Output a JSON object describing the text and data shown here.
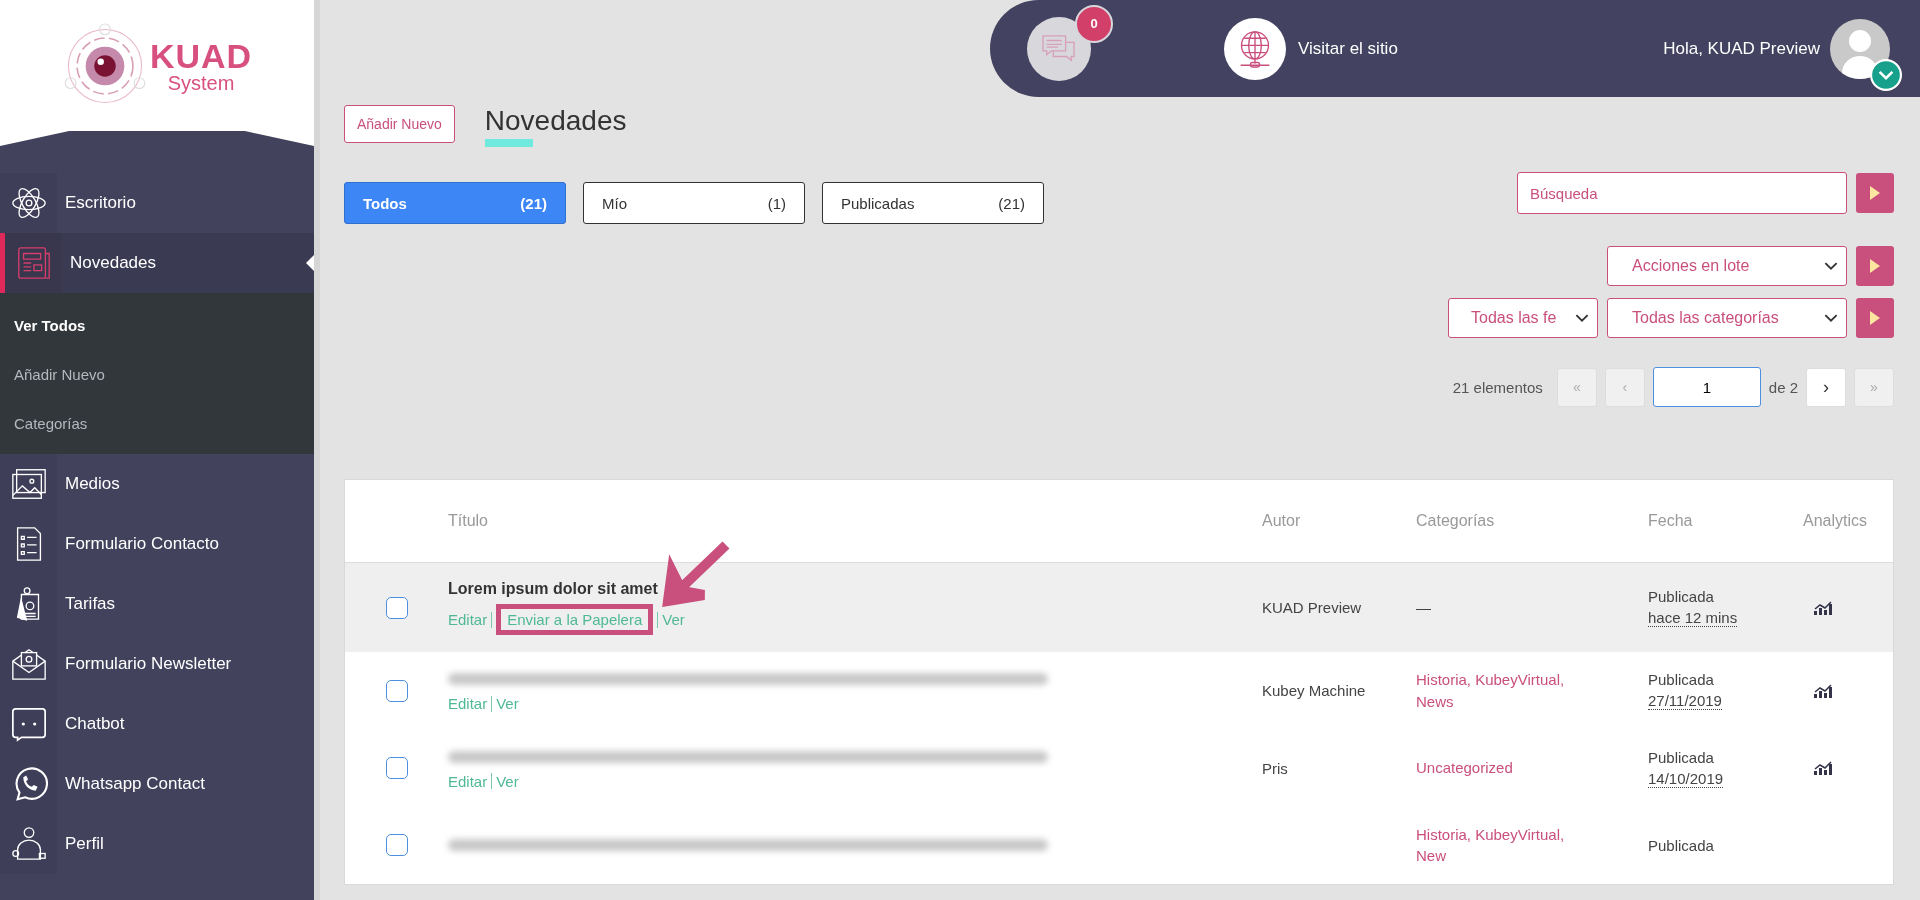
{
  "logo": {
    "word": "KUAD",
    "sub": "System"
  },
  "sidebar": {
    "items": [
      {
        "label": "Escritorio",
        "selected": false
      },
      {
        "label": "Novedades",
        "selected": true,
        "expanded": true,
        "children": [
          {
            "label": "Ver Todos",
            "selected": true
          },
          {
            "label": "Añadir Nuevo",
            "selected": false
          },
          {
            "label": "Categorías",
            "selected": false
          }
        ]
      },
      {
        "label": "Medios",
        "selected": false
      },
      {
        "label": "Formulario Contacto",
        "selected": false
      },
      {
        "label": "Tarifas",
        "selected": false
      },
      {
        "label": "Formulario Newsletter",
        "selected": false
      },
      {
        "label": "Chatbot",
        "selected": false
      },
      {
        "label": "Whatsapp Contact",
        "selected": false
      },
      {
        "label": "Perfil",
        "selected": false
      }
    ]
  },
  "topbar": {
    "messages_badge": "0",
    "visit_site": "Visitar el sitio",
    "greeting": "Hola, KUAD Preview"
  },
  "page": {
    "add_button": "Añadir Nuevo",
    "title": "Novedades"
  },
  "views": [
    {
      "label": "Todos",
      "count": "(21)",
      "selected": true
    },
    {
      "label": "Mío",
      "count": "(1)",
      "selected": false
    },
    {
      "label": "Publicadas",
      "count": "(21)",
      "selected": false
    }
  ],
  "search": {
    "placeholder": "Búsqueda"
  },
  "bulk_actions": {
    "value": "Acciones en lote"
  },
  "filters": [
    {
      "value": "Todas las fe"
    },
    {
      "value": "Todas las categorías"
    }
  ],
  "pagination": {
    "count": "21 elementos",
    "first": {
      "label": "«",
      "disabled": true
    },
    "prev": {
      "label": "‹",
      "disabled": true
    },
    "page": "1",
    "of": "de 2",
    "next": {
      "label": "›",
      "disabled": false
    },
    "last": {
      "label": "»",
      "disabled": true
    }
  },
  "table": {
    "columns": [
      "Título",
      "Autor",
      "Categorías",
      "Fecha",
      "Analytics"
    ],
    "rows": [
      {
        "checked": false,
        "hovered": true,
        "title": {
          "kind": "text",
          "text": "Lorem ipsum dolor sit amet"
        },
        "actions": [
          {
            "label": "Editar",
            "highlighted": false
          },
          {
            "label": "Enviar a la Papelera",
            "highlighted": true
          },
          {
            "label": "Ver",
            "highlighted": false
          }
        ],
        "author": "KUAD Preview",
        "categories": {
          "kind": "empty",
          "text": "—"
        },
        "status": "Publicada",
        "date": "hace 12 mins"
      },
      {
        "checked": false,
        "hovered": false,
        "title": {
          "kind": "blurred"
        },
        "actions": [
          {
            "label": "Editar",
            "highlighted": false
          },
          {
            "label": "Ver",
            "highlighted": false
          }
        ],
        "author": "Kubey Machine",
        "categories": {
          "kind": "links",
          "text": "Historia, KubeyVirtual, News"
        },
        "status": "Publicada",
        "date": "27/11/2019"
      },
      {
        "checked": false,
        "hovered": false,
        "title": {
          "kind": "blurred"
        },
        "actions": [
          {
            "label": "Editar",
            "highlighted": false
          },
          {
            "label": "Ver",
            "highlighted": false
          }
        ],
        "author": "Pris",
        "categories": {
          "kind": "links",
          "text": "Uncategorized"
        },
        "status": "Publicada",
        "date": "14/10/2019"
      },
      {
        "checked": false,
        "hovered": false,
        "title": {
          "kind": "blurred"
        },
        "categories": {
          "kind": "links",
          "text": "Historia, KubeyVirtual, New"
        },
        "status": "Publicada"
      }
    ]
  }
}
